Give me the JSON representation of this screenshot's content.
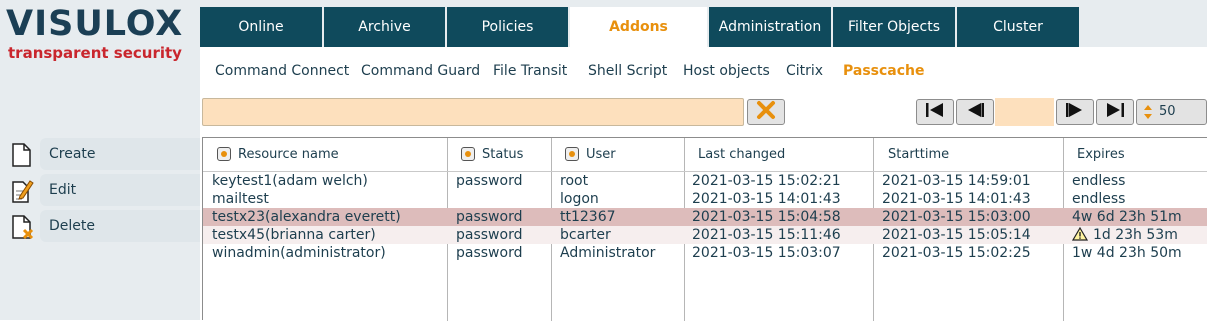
{
  "logo": {
    "title": "VISULOX",
    "subtitle": "transparent security"
  },
  "sidebar": {
    "actions": [
      {
        "label": "Create",
        "icon": "create-document-icon"
      },
      {
        "label": "Edit",
        "icon": "edit-document-icon"
      },
      {
        "label": "Delete",
        "icon": "delete-document-icon"
      }
    ]
  },
  "tabs": [
    {
      "label": "Online",
      "active": false
    },
    {
      "label": "Archive",
      "active": false
    },
    {
      "label": "Policies",
      "active": false
    },
    {
      "label": "Addons",
      "active": true
    },
    {
      "label": "Administration",
      "active": false
    },
    {
      "label": "Filter Objects",
      "active": false
    },
    {
      "label": "Cluster",
      "active": false
    }
  ],
  "subtabs": [
    {
      "label": "Command Connect",
      "active": false
    },
    {
      "label": "Command Guard",
      "active": false
    },
    {
      "label": "File Transit",
      "active": false
    },
    {
      "label": "Shell Script",
      "active": false
    },
    {
      "label": "Host objects",
      "active": false
    },
    {
      "label": "Citrix",
      "active": false
    },
    {
      "label": "Passcache",
      "active": true
    }
  ],
  "filter": {
    "value": "",
    "clear_icon": "clear-x-icon"
  },
  "pagination": {
    "first_icon": "first-page-icon",
    "prev_icon": "prev-page-icon",
    "page_value": "",
    "next_icon": "next-page-icon",
    "last_icon": "last-page-icon",
    "page_size": "50",
    "page_size_icon": "up-down-arrows-icon"
  },
  "table": {
    "columns": [
      {
        "label": "Resource name",
        "sortable": true
      },
      {
        "label": "Status",
        "sortable": true
      },
      {
        "label": "User",
        "sortable": true
      },
      {
        "label": "Last changed",
        "sortable": false
      },
      {
        "label": "Starttime",
        "sortable": false
      },
      {
        "label": "Expires",
        "sortable": false
      }
    ],
    "rows": [
      {
        "resource": "keytest1(adam welch)",
        "status": "password",
        "user": "root",
        "last_changed": "2021-03-15 15:02:21",
        "starttime": "2021-03-15 14:59:01",
        "expires": "endless",
        "warning": false,
        "state": "normal"
      },
      {
        "resource": "mailtest",
        "status": "",
        "user": "logon",
        "last_changed": "2021-03-15 14:01:43",
        "starttime": "2021-03-15 14:01:43",
        "expires": "endless",
        "warning": false,
        "state": "normal"
      },
      {
        "resource": "testx23(alexandra everett)",
        "status": "password",
        "user": "tt12367",
        "last_changed": "2021-03-15 15:04:58",
        "starttime": "2021-03-15 15:03:00",
        "expires": "4w 6d 23h 51m",
        "warning": false,
        "state": "selected"
      },
      {
        "resource": "testx45(brianna carter)",
        "status": "password",
        "user": "bcarter",
        "last_changed": "2021-03-15 15:11:46",
        "starttime": "2021-03-15 15:05:14",
        "expires": "1d 23h 53m",
        "warning": true,
        "state": "highlight"
      },
      {
        "resource": "winadmin(administrator)",
        "status": "password",
        "user": "Administrator",
        "last_changed": "2021-03-15 15:03:07",
        "starttime": "2021-03-15 15:02:25",
        "expires": "1w 4d 23h 50m",
        "warning": false,
        "state": "normal"
      }
    ]
  },
  "colors": {
    "brand_dark": "#1b3f55",
    "brand_red": "#c9262d",
    "tab_bg": "#0f4a5c",
    "accent": "#e8900d",
    "input_bg": "#fde0bd",
    "selected_row": "#ddbcbb"
  }
}
